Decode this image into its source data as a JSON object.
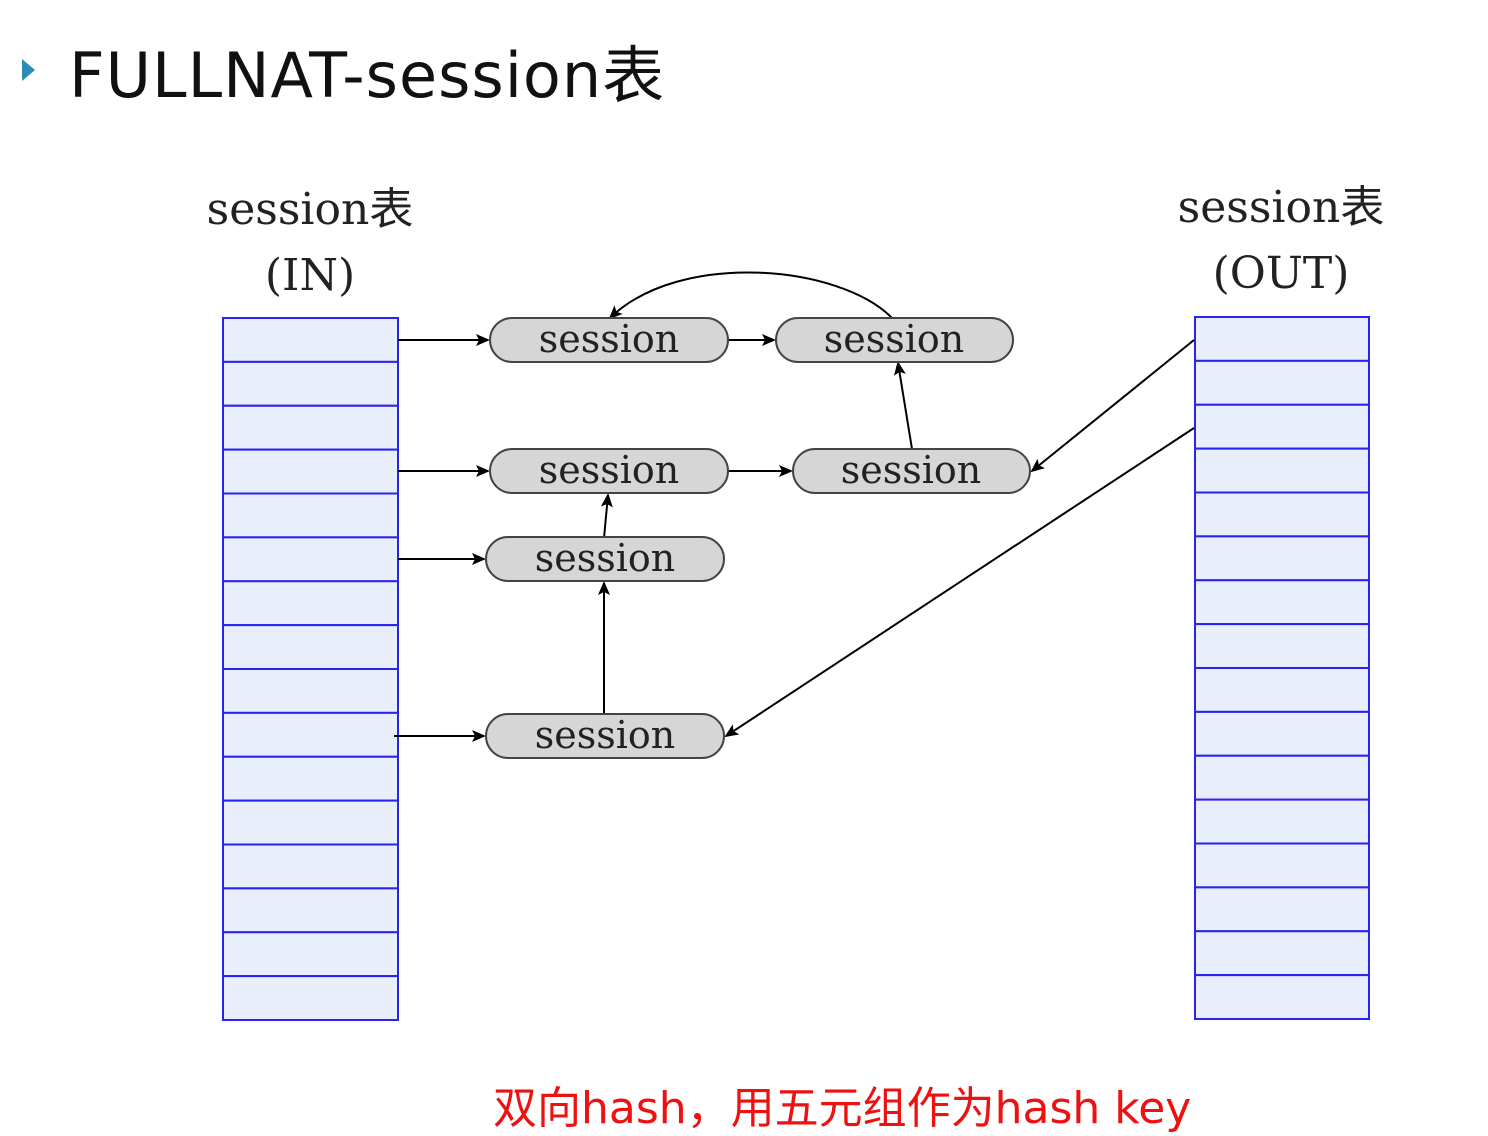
{
  "title": "FULLNAT-session表",
  "tables": [
    {
      "id": "in",
      "label_line1": "session表",
      "label_line2": "(IN)",
      "rows": 16
    },
    {
      "id": "out",
      "label_line1": "session表",
      "label_line2": "(OUT)",
      "rows": 16
    }
  ],
  "nodes": [
    {
      "id": "s1",
      "label": "session"
    },
    {
      "id": "s2",
      "label": "session"
    },
    {
      "id": "s3",
      "label": "session"
    },
    {
      "id": "s4",
      "label": "session"
    },
    {
      "id": "s5",
      "label": "session"
    },
    {
      "id": "s6",
      "label": "session"
    }
  ],
  "caption": "双向hash，用五元组作为hash key",
  "colors": {
    "table_stroke": "#2a22ee",
    "table_fill": "#e8eefa",
    "node_fill": "#d6d6d6",
    "node_stroke": "#444444",
    "caption": "#ee1111",
    "bullet": "#2a8db5"
  }
}
